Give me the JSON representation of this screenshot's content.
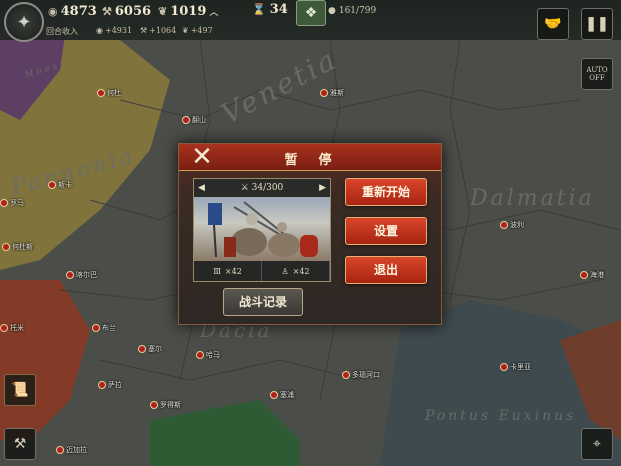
{
  "resources": {
    "gold": "4873",
    "industry": "6056",
    "food": "1019",
    "income_label": "回合收入",
    "gold_income": "+4931",
    "industry_income": "+1064",
    "food_income": "+497"
  },
  "turn": {
    "value": "34"
  },
  "population": {
    "value": "161/799"
  },
  "auto_label": "AUTO",
  "auto_state": "OFF",
  "map_labels": [
    "Venetia",
    "Pannonia",
    "Dacia",
    "Dalmatia",
    "Pontus  Euxinus",
    "Moesia"
  ],
  "cities": [
    "何杜",
    "雅斯",
    "翻山",
    "斯卡",
    "罗马",
    "何杜斯",
    "喀尔巴",
    "托米",
    "布兰",
    "塞尔",
    "哈马",
    "萨拉",
    "多瑙河口",
    "波利",
    "海港",
    "卡里亚",
    "塞浦",
    "罗得斯",
    "迈加拉"
  ],
  "dialog": {
    "title": "暂　停",
    "battle_count": "34/300",
    "unit_count_a": "×42",
    "unit_count_b": "×42",
    "restart": "重新开始",
    "settings": "设置",
    "quit": "退出",
    "battle_log": "战斗记录"
  },
  "colors": {
    "header_red": "#a8321e",
    "button_red": "#d8462a",
    "accent_gold": "#caa060"
  }
}
